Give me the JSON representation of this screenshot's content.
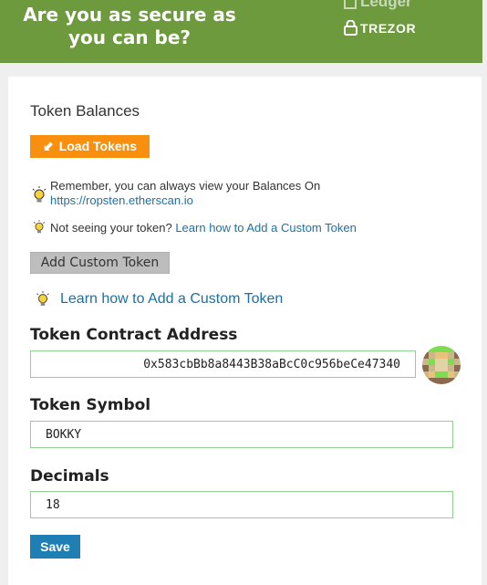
{
  "banner": {
    "text": "Are you as secure as you can be?",
    "ledger_label": "Ledger",
    "trezor_label": "TREZOR"
  },
  "panel": {
    "title": "Token Balances",
    "load_button": "Load Tokens",
    "remember_text": "Remember, you can always view your Balances On",
    "etherscan_link": "https://ropsten.etherscan.io",
    "not_seeing_text": "Not seeing your token?",
    "learn_link_small": "Learn how to Add a Custom Token",
    "add_custom_button": "Add Custom Token",
    "learn_link_large": "Learn how to Add a Custom Token"
  },
  "form": {
    "contract_label": "Token Contract Address",
    "contract_value": "0x583cbBb8a8443B38aBcC0c956beCe47340",
    "symbol_label": "Token Symbol",
    "symbol_value": "BOKKY",
    "decimals_label": "Decimals",
    "decimals_value": "18",
    "save_button": "Save"
  },
  "colors": {
    "banner_bg": "#6c9a3c",
    "load_button_bg": "#f98f0e",
    "save_button_bg": "#1f7fb4",
    "link": "#1d70a3",
    "field_border": "#8fd28f"
  },
  "icons": [
    "lock-icon",
    "lightbulb-icon",
    "refresh-arrow-icon",
    "identicon"
  ]
}
